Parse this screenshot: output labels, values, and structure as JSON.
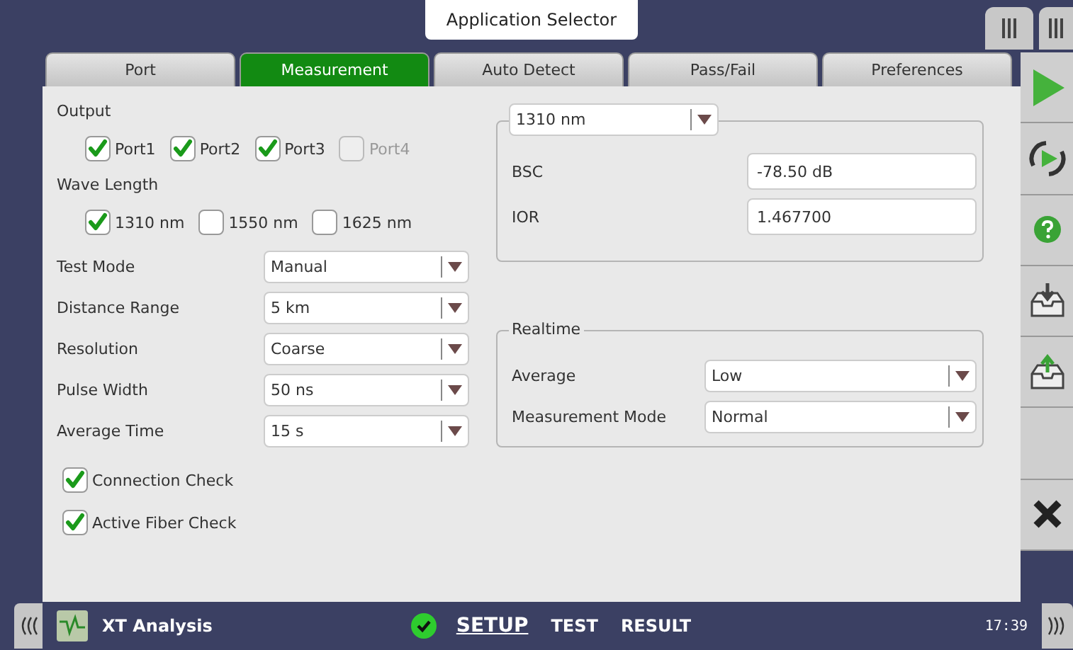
{
  "app_selector": {
    "title": "Application Selector"
  },
  "tabs": [
    {
      "label": "Port",
      "selected": false
    },
    {
      "label": "Measurement",
      "selected": true
    },
    {
      "label": "Auto Detect",
      "selected": false
    },
    {
      "label": "Pass/Fail",
      "selected": false
    },
    {
      "label": "Preferences",
      "selected": false
    }
  ],
  "output": {
    "label": "Output",
    "options": [
      {
        "label": "Port1",
        "checked": true,
        "disabled": false
      },
      {
        "label": "Port2",
        "checked": true,
        "disabled": false
      },
      {
        "label": "Port3",
        "checked": true,
        "disabled": false
      },
      {
        "label": "Port4",
        "checked": false,
        "disabled": true
      }
    ]
  },
  "wave_length": {
    "label": "Wave Length",
    "options": [
      {
        "label": "1310 nm",
        "checked": true,
        "disabled": false
      },
      {
        "label": "1550 nm",
        "checked": false,
        "disabled": false
      },
      {
        "label": "1625 nm",
        "checked": false,
        "disabled": false
      }
    ]
  },
  "settings": [
    {
      "label": "Test Mode",
      "value": "Manual"
    },
    {
      "label": "Distance Range",
      "value": "5 km"
    },
    {
      "label": "Resolution",
      "value": "Coarse"
    },
    {
      "label": "Pulse Width",
      "value": "50 ns"
    },
    {
      "label": "Average Time",
      "value": "15 s"
    }
  ],
  "checks": [
    {
      "label": "Connection Check",
      "checked": true
    },
    {
      "label": "Active Fiber Check",
      "checked": true
    }
  ],
  "fiber": {
    "wavelength": "1310 nm",
    "fields": [
      {
        "label": "BSC",
        "value": "-78.50 dB"
      },
      {
        "label": "IOR",
        "value": "1.467700"
      }
    ]
  },
  "realtime": {
    "title": "Realtime",
    "rows": [
      {
        "label": "Average",
        "value": "Low"
      },
      {
        "label": "Measurement Mode",
        "value": "Normal"
      }
    ]
  },
  "sidebar": [
    {
      "kind": "play"
    },
    {
      "kind": "refresh"
    },
    {
      "kind": "help"
    },
    {
      "kind": "save"
    },
    {
      "kind": "load"
    },
    {
      "kind": "blank"
    },
    {
      "kind": "close"
    }
  ],
  "status_bar": {
    "app": "XT Analysis",
    "status_ok": true,
    "nav": [
      {
        "label": "SETUP",
        "selected": true
      },
      {
        "label": "TEST",
        "selected": false
      },
      {
        "label": "RESULT",
        "selected": false
      }
    ],
    "time": "17:39"
  }
}
